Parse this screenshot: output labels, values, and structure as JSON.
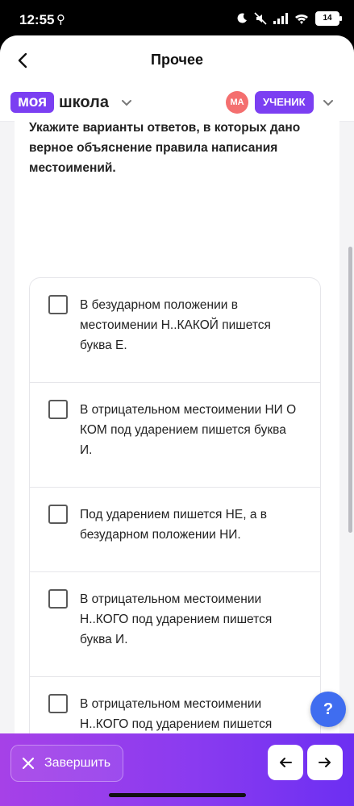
{
  "status_bar": {
    "time": "12:55",
    "battery": "14"
  },
  "header": {
    "title": "Прочее"
  },
  "brand": {
    "logo_part1": "моя",
    "logo_part2": "школа",
    "avatar_initials": "МА",
    "role": "УЧЕНИК"
  },
  "question": {
    "text": "Укажите варианты ответов, в которых дано верное объяснение правила написания местоимений."
  },
  "options": [
    {
      "text": "В безударном положении в местоимении Н..КАКОЙ пишется буква Е."
    },
    {
      "text": "В отрицательном местоимении НИ О КОМ под ударением пишется буква И."
    },
    {
      "text": "Под ударением пишется НЕ, а в безударном положении НИ."
    },
    {
      "text": "В отрицательном местоимении Н..КОГО под ударением пишется буква И."
    },
    {
      "text": "В отрицательном местоимении Н..КОГО под ударением пишется буква Е."
    }
  ],
  "help": {
    "label": "?"
  },
  "footer": {
    "finish_label": "Завершить"
  },
  "colors": {
    "accent": "#7b3ff2",
    "help": "#3f6df0",
    "avatar": "#f46f6f"
  }
}
